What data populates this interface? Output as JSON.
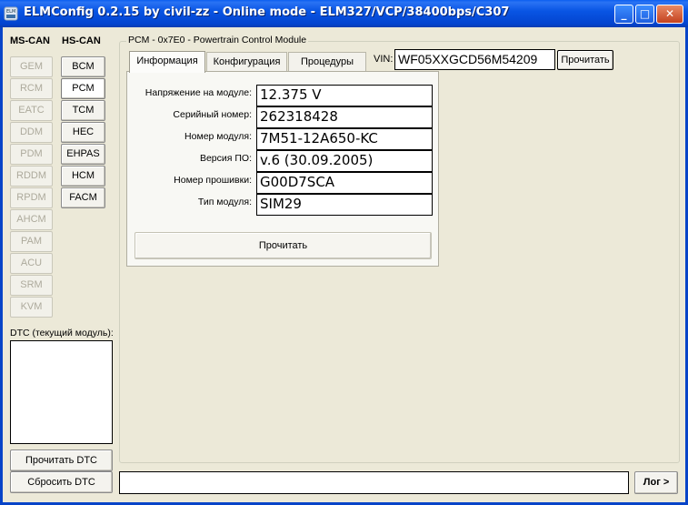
{
  "window": {
    "title": "ELMConfig 0.2.15 by civil-zz - Online mode - ELM327/VCP/38400bps/C307",
    "controls": {
      "minimize": "_",
      "maximize": "□",
      "close": "✕"
    }
  },
  "left_panel": {
    "ms_can_header": "MS-CAN",
    "hs_can_header": "HS-CAN",
    "ms_can_modules": [
      "GEM",
      "RCM",
      "EATC",
      "DDM",
      "PDM",
      "RDDM",
      "RPDM",
      "AHCM",
      "PAM",
      "ACU",
      "SRM",
      "KVM"
    ],
    "hs_can_modules": [
      "BCM",
      "PCM",
      "TCM",
      "HEC",
      "EHPAS",
      "HCM",
      "FACM"
    ],
    "selected_module": "PCM",
    "dtc_label": "DTC (текущий модуль):",
    "read_dtc_button": "Прочитать DTC",
    "clear_dtc_button": "Сбросить DTC"
  },
  "module_group": {
    "title": "PCM - 0x7E0 - Powertrain Control Module",
    "tabs": [
      "Информация",
      "Конфигурация",
      "Процедуры"
    ],
    "active_tab": "Информация",
    "vin_label": "VIN:",
    "vin_value": "WF05XXGCD56M54209",
    "vin_read_button": "Прочитать",
    "info_rows": [
      {
        "label": "Напряжение на модуле:",
        "value": "12.375 V"
      },
      {
        "label": "Серийный номер:",
        "value": "262318428"
      },
      {
        "label": "Номер модуля:",
        "value": "7M51-12A650-KC"
      },
      {
        "label": "Версия ПО:",
        "value": "v.6 (30.09.2005)"
      },
      {
        "label": "Номер прошивки:",
        "value": "G00D7SCA"
      },
      {
        "label": "Тип модуля:",
        "value": "SIM29"
      }
    ],
    "read_button": "Прочитать"
  },
  "status_bar": {
    "text": "",
    "log_button": "Лог >"
  },
  "colors": {
    "titlebar": "#0a5ef0",
    "window_bg": "#ece9d8",
    "disabled_text": "#adaa9c"
  }
}
